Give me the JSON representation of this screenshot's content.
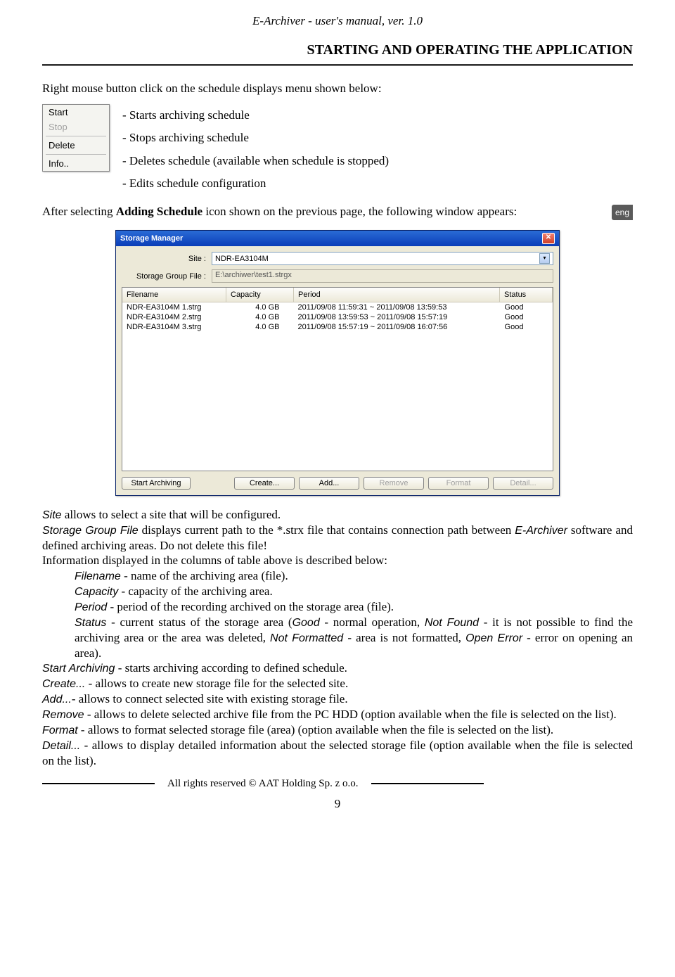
{
  "header": {
    "title": "E-Archiver - user's manual, ver. 1.0"
  },
  "section_title": "STARTING AND OPERATING THE APPLICATION",
  "intro": "Right mouse button click on the schedule displays menu shown below:",
  "context_menu": {
    "start": "Start",
    "stop": "Stop",
    "delete": "Delete",
    "info": "Info.."
  },
  "menu_desc": {
    "l1": "- Starts archiving schedule",
    "l2": "- Stops archiving schedule",
    "l3": "- Deletes schedule (available when schedule is stopped)",
    "l4": "- Edits schedule configuration"
  },
  "followup_pre": "After selecting ",
  "followup_bold": "Adding Schedule",
  "followup_post": " icon shown on the previous page, the following window appears:",
  "eng_tab": "eng",
  "storage_manager": {
    "title": "Storage Manager",
    "close": "✕",
    "site_label": "Site :",
    "site_value": "NDR-EA3104M",
    "group_label": "Storage Group File :",
    "group_value": "E:\\archiwer\\test1.strgx",
    "columns": {
      "c1": "Filename",
      "c2": "Capacity",
      "c3": "Period",
      "c4": "Status"
    },
    "rows": [
      {
        "filename": "NDR-EA3104M 1.strg",
        "capacity": "4.0 GB",
        "period": "2011/09/08 11:59:31 ~ 2011/09/08 13:59:53",
        "status": "Good"
      },
      {
        "filename": "NDR-EA3104M 2.strg",
        "capacity": "4.0 GB",
        "period": "2011/09/08 13:59:53 ~ 2011/09/08 15:57:19",
        "status": "Good"
      },
      {
        "filename": "NDR-EA3104M 3.strg",
        "capacity": "4.0 GB",
        "period": "2011/09/08 15:57:19 ~ 2011/09/08 16:07:56",
        "status": "Good"
      }
    ],
    "buttons": {
      "start": "Start Archiving",
      "create": "Create...",
      "add": "Add...",
      "remove": "Remove",
      "format": "Format",
      "detail": "Detail..."
    }
  },
  "body": {
    "site_label": "Site",
    "site_rest": " allows to select a site that will be configured.",
    "sgf_label": "Storage Group File",
    "sgf_rest_1": " displays current path to the *.strx file that contains connection path between ",
    "sgf_italic2": "E-Archiver",
    "sgf_rest_2": " software and defined archiving areas. Do not delete this file!",
    "cols_intro": "Information displayed in the columns of table above is described below:",
    "filename_label": "Filename",
    "filename_rest": " - name of the archiving area (file).",
    "capacity_label": "Capacity",
    "capacity_rest": " - capacity of the archiving area.",
    "period_label": "Period",
    "period_rest": " - period of the recording archived on the storage area (file).",
    "status_label": "Status",
    "status_rest_1": " - current status of the storage area (",
    "status_good": "Good",
    "status_rest_2": " - normal operation, ",
    "status_nf": "Not Found",
    "status_rest_3": " - it is not possible to find the archiving area or the area was deleted, ",
    "status_nfmt": "Not Formatted ",
    "status_rest_4": "- area is not formatted, ",
    "status_oe": "Open Error",
    "status_rest_5": " - error on opening an area).",
    "start_label": "Start Archiving",
    "start_rest": " - starts archiving according to defined schedule.",
    "create_label": "Create...",
    "create_rest": " - allows to create new storage file for the selected site.",
    "add_label": "Add...",
    "add_rest": "- allows to connect selected site with existing storage file.",
    "remove_label": "Remove",
    "remove_rest": " - allows to delete selected archive file from the PC HDD (option available when the file is selected on the list).",
    "format_label": "Format",
    "format_rest": " - allows to format selected storage file (area) (option available when the file is selected on the list).",
    "detail_label": "Detail...",
    "detail_rest": " - allows to display detailed information about the selected storage file (option available when the file is selected on the list)."
  },
  "footer": {
    "rights": "All rights reserved © AAT Holding Sp. z o.o.",
    "page": "9"
  }
}
